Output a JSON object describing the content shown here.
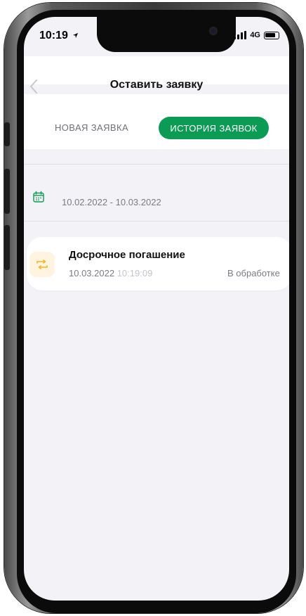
{
  "status_bar": {
    "time": "10:19",
    "network": "4G"
  },
  "header": {
    "title": "Оставить заявку"
  },
  "tabs": [
    {
      "label": "НОВАЯ ЗАЯВКА",
      "active": false
    },
    {
      "label": "ИСТОРИЯ ЗАЯВОК",
      "active": true
    }
  ],
  "filter": {
    "date_range": "10.02.2022 - 10.03.2022"
  },
  "requests": [
    {
      "title": "Досрочное погашение",
      "date": "10.03.2022",
      "time": "10:19:09",
      "status": "В обработке"
    }
  ],
  "colors": {
    "accent": "#0c9b54",
    "icon_orange": "#f5b323",
    "background": "#f3f3f7"
  }
}
